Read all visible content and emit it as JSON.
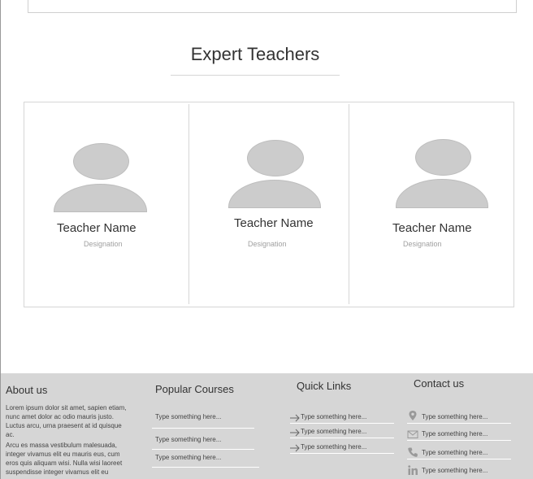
{
  "teachers_section": {
    "title": "Expert Teachers",
    "teachers": [
      {
        "name": "Teacher Name",
        "designation": "Designation"
      },
      {
        "name": "Teacher Name",
        "designation": "Designation"
      },
      {
        "name": "Teacher Name",
        "designation": "Designation"
      }
    ]
  },
  "footer": {
    "about": {
      "heading": "About us",
      "paragraph1": "Lorem ipsum dolor sit amet, sapien etiam, nunc amet dolor ac odio mauris justo. Luctus arcu, urna praesent at id quisque ac.",
      "paragraph2": "Arcu es massa vestibulum malesuada, integer vivamus elit eu mauris eus, cum eros quis aliquam wisi. Nulla wisi laoreet suspendisse integer vivamus elit eu mauris"
    },
    "courses": {
      "heading": "Popular Courses",
      "items": [
        "Type something here...",
        "Type something here...",
        "Type something here..."
      ]
    },
    "quick_links": {
      "heading": "Quick Links",
      "items": [
        "Type something here...",
        "Type something here...",
        "Type something here..."
      ]
    },
    "contact": {
      "heading": "Contact us",
      "items": [
        {
          "icon": "location-pin-icon",
          "text": "Type something here..."
        },
        {
          "icon": "envelope-icon",
          "text": "Type something here..."
        },
        {
          "icon": "phone-icon",
          "text": "Type something here..."
        },
        {
          "icon": "linkedin-icon",
          "text": "Type something here..."
        }
      ]
    }
  }
}
